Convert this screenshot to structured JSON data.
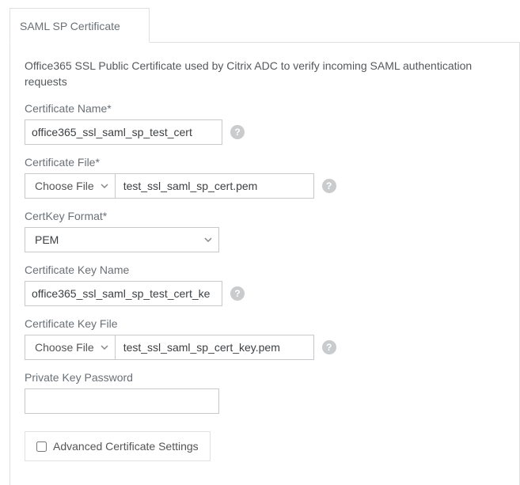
{
  "tab": {
    "label": "SAML SP Certificate"
  },
  "description": "Office365 SSL Public Certificate used by Citrix ADC to verify incoming SAML authentication requests",
  "fields": {
    "cert_name": {
      "label": "Certificate Name*",
      "value": "office365_ssl_saml_sp_test_cert"
    },
    "cert_file": {
      "label": "Certificate File*",
      "button": "Choose File",
      "filename": "test_ssl_saml_sp_cert.pem"
    },
    "key_format": {
      "label": "CertKey Format*",
      "value": "PEM"
    },
    "key_name": {
      "label": "Certificate Key Name",
      "value": "office365_ssl_saml_sp_test_cert_ke"
    },
    "key_file": {
      "label": "Certificate Key File",
      "button": "Choose File",
      "filename": "test_ssl_saml_sp_cert_key.pem"
    },
    "pkey_pw": {
      "label": "Private Key Password",
      "value": ""
    }
  },
  "advanced": {
    "label": "Advanced Certificate Settings"
  },
  "glyphs": {
    "help": "?"
  }
}
